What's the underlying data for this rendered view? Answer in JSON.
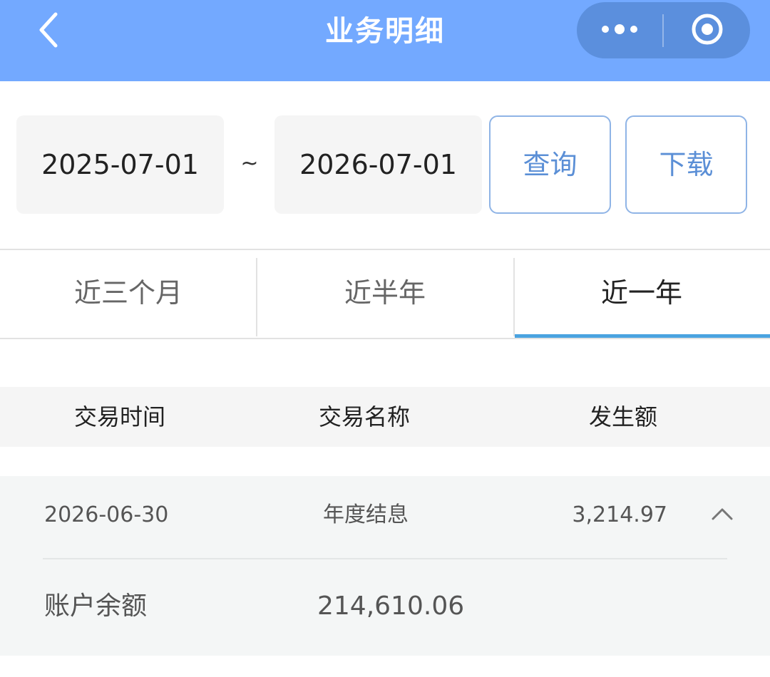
{
  "header": {
    "title": "业务明细",
    "back_icon": "chevron-left-icon",
    "more_icon": "more-dots-icon",
    "close_icon": "target-circle-icon",
    "background_color": "#73a9ff"
  },
  "filter": {
    "start_date": "2025-07-01",
    "separator": "~",
    "end_date": "2026-07-01",
    "query_label": "查询",
    "download_label": "下载"
  },
  "tabs": [
    {
      "label": "近三个月",
      "active": false
    },
    {
      "label": "近半年",
      "active": false
    },
    {
      "label": "近一年",
      "active": true
    }
  ],
  "table": {
    "columns": [
      "交易时间",
      "交易名称",
      "发生额"
    ],
    "records": [
      {
        "date": "2026-06-30",
        "name": "年度结息",
        "amount": "3,214.97",
        "expanded": true,
        "detail_label": "账户余额",
        "detail_value": "214,610.06"
      }
    ]
  },
  "colors": {
    "accent_blue": "#4aa3e0",
    "button_text": "#5b8fd6"
  }
}
